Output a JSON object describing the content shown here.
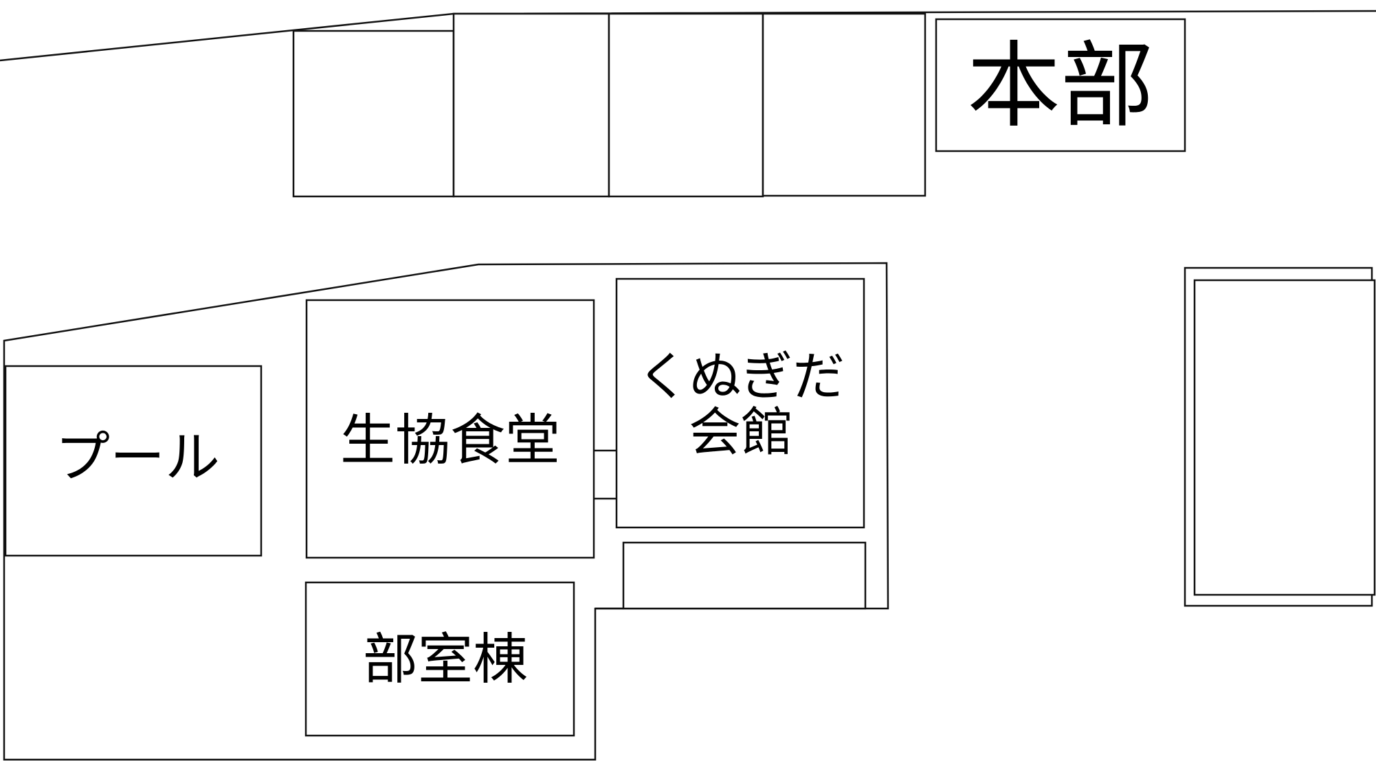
{
  "colors": {
    "line": "#111111",
    "background": "#ffffff",
    "text": "#000000"
  },
  "buildings": {
    "honbu": "本部",
    "pool": "プール",
    "coop_cafeteria": "生協食堂",
    "kumegida_line1": "くぬぎだ",
    "kumegida_line2": "会館",
    "club_building": "部室棟"
  }
}
